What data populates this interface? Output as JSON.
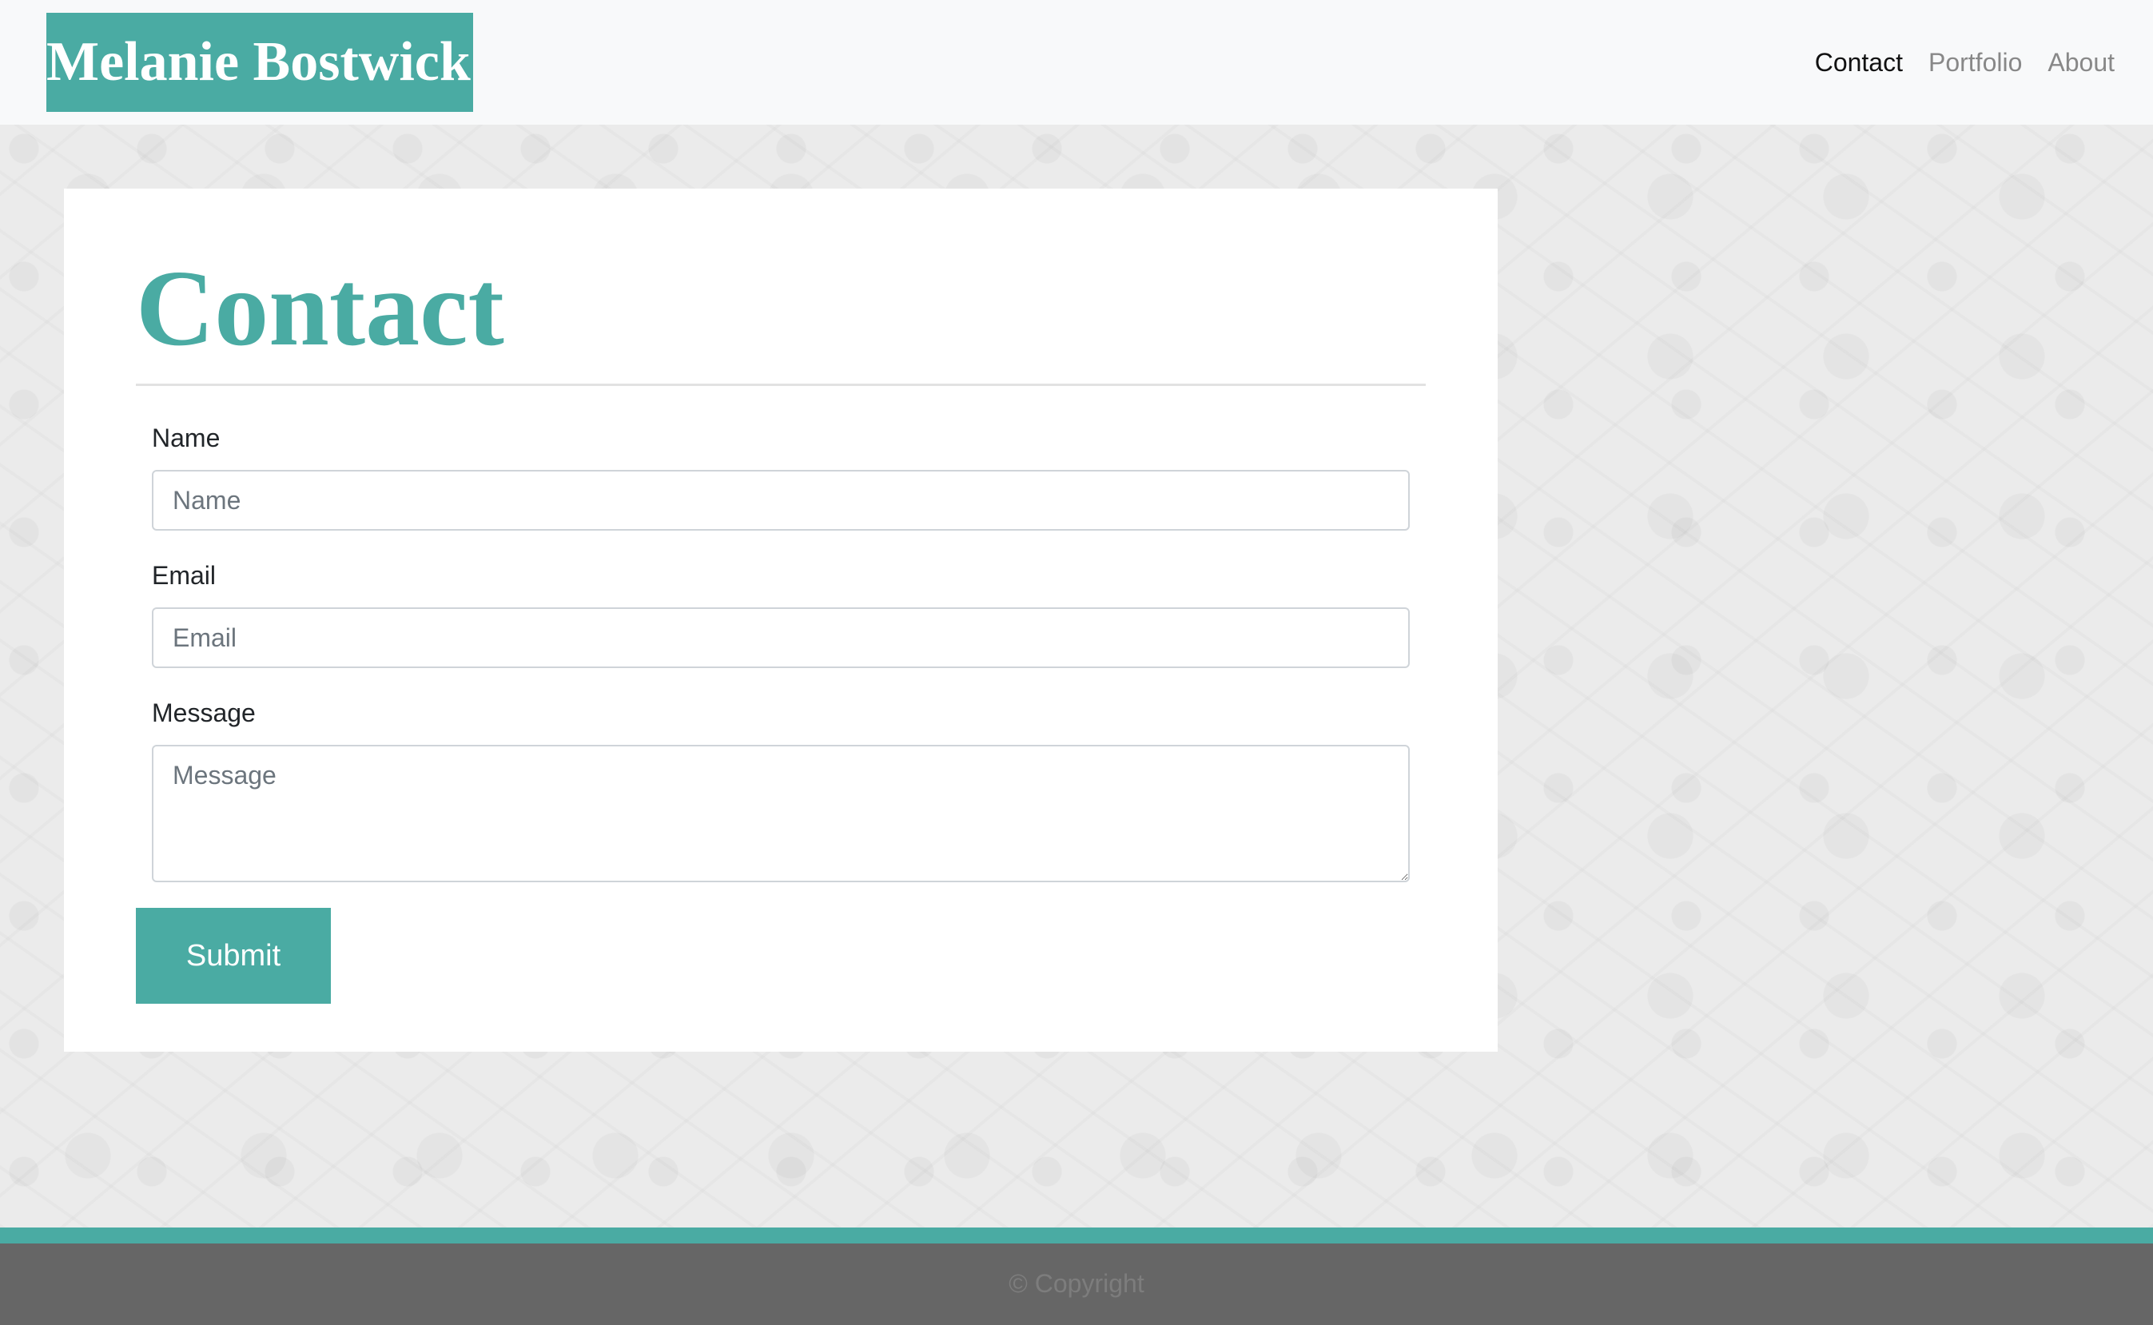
{
  "header": {
    "brand": "Melanie Bostwick",
    "nav": [
      {
        "label": "Contact",
        "active": true
      },
      {
        "label": "Portfolio",
        "active": false
      },
      {
        "label": "About",
        "active": false
      }
    ]
  },
  "main": {
    "title": "Contact",
    "form": {
      "name_label": "Name",
      "name_placeholder": "Name",
      "name_value": "",
      "email_label": "Email",
      "email_placeholder": "Email",
      "email_value": "",
      "message_label": "Message",
      "message_placeholder": "Message",
      "message_value": "",
      "submit_label": "Submit"
    }
  },
  "footer": {
    "copyright": "© Copyright"
  },
  "colors": {
    "accent": "#4aaba3",
    "navbar_bg": "#f8f9fa",
    "page_bg": "#ebebeb",
    "footer_bg": "#666666"
  }
}
